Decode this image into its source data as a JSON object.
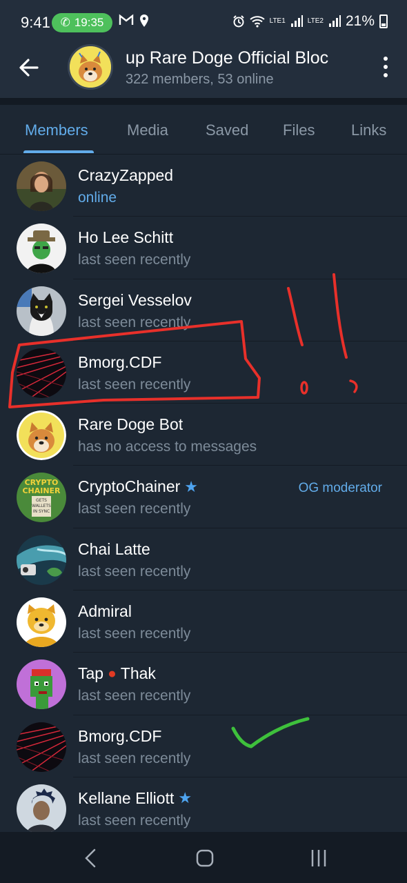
{
  "status_bar": {
    "time": "9:41",
    "call_time": "19:35",
    "carrier_1": "LTE1",
    "carrier_2": "LTE2",
    "battery": "21%",
    "icons": [
      "phone-icon",
      "gmail-icon",
      "location-icon",
      "alarm-icon",
      "wifi-icon",
      "signal-icon",
      "battery-icon"
    ]
  },
  "header": {
    "title": "up   Rare Doge Official Bloc",
    "subtitle": "322 members, 53 online",
    "back_icon": "back-arrow-icon",
    "menu_icon": "more-vert-icon"
  },
  "tabs": [
    {
      "label": "Members",
      "active": true
    },
    {
      "label": "Media",
      "active": false
    },
    {
      "label": "Saved",
      "active": false
    },
    {
      "label": "Files",
      "active": false
    },
    {
      "label": "Links",
      "active": false
    }
  ],
  "members": [
    {
      "name": "CrazyZapped",
      "status": "online",
      "online": true
    },
    {
      "name": "Ho Lee Schitt",
      "status": "last seen recently"
    },
    {
      "name": "Sergei Vesselov",
      "status": "last seen recently"
    },
    {
      "name": "Bmorg.CDF",
      "status": "last seen recently"
    },
    {
      "name": "Rare Doge Bot",
      "status": "has no access to messages"
    },
    {
      "name": "CryptoChainer",
      "status": "last seen recently",
      "badge": "star-icon",
      "role": "OG moderator"
    },
    {
      "name": "Chai Latte",
      "status": "last seen recently"
    },
    {
      "name": "Admiral",
      "status": "last seen recently"
    },
    {
      "name_a": "Tap",
      "name_b": "Thak",
      "status": "last seen recently",
      "emoji": "tomato-icon"
    },
    {
      "name": "Bmorg.CDF",
      "status": "last seen recently"
    },
    {
      "name": "Kellane Elliott",
      "status": "last seen recently",
      "badge": "star-icon"
    }
  ],
  "avatar_text": {
    "cryptochainer_1": "CRYPTO",
    "cryptochainer_2": "CHAINER",
    "cryptochainer_3": "GETS",
    "cryptochainer_4": "WALLETS",
    "cryptochainer_5": "IN SYNC"
  },
  "colors": {
    "background": "#1d2733",
    "header": "#232e3c",
    "accent": "#62acea",
    "call_pill": "#4ec05c",
    "annotation_red": "#e8302a",
    "annotation_green": "#3ec03c"
  }
}
